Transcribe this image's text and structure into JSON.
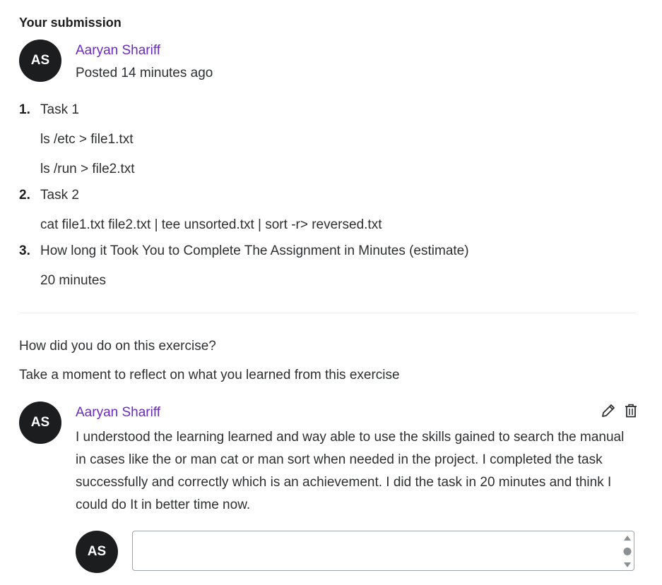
{
  "submission": {
    "title": "Your submission",
    "avatar_initials": "AS",
    "author": "Aaryan Shariff",
    "posted": "Posted 14 minutes ago"
  },
  "tasks": [
    {
      "number": "1.",
      "title": "Task 1",
      "lines": [
        "ls /etc > file1.txt",
        "ls /run > file2.txt"
      ]
    },
    {
      "number": "2.",
      "title": "Task 2",
      "lines": [
        "cat file1.txt file2.txt | tee unsorted.txt | sort -r> reversed.txt"
      ]
    },
    {
      "number": "3.",
      "title": "How long it Took You to Complete The Assignment in Minutes (estimate)",
      "lines": [
        "20 minutes"
      ]
    }
  ],
  "reflection": {
    "question": "How did you do on this exercise?",
    "prompt": "Take a moment to reflect on what you learned from this exercise"
  },
  "comment": {
    "avatar_initials": "AS",
    "author": "Aaryan Shariff",
    "body": "I understood the learning learned and way able to use the skills gained to search the manual in cases like the or man cat or man sort when needed in the project. I completed the task successfully and correctly which is an achievement. I did the task in 20 minutes and think I could do It in  better time now.",
    "edit_icon": "pencil-icon",
    "delete_icon": "trash-icon"
  },
  "reply": {
    "avatar_initials": "AS",
    "value": "",
    "placeholder": ""
  },
  "colors": {
    "accent": "#6a2ac1",
    "avatar_bg": "#1c1d1f",
    "text": "#2d2f31"
  }
}
